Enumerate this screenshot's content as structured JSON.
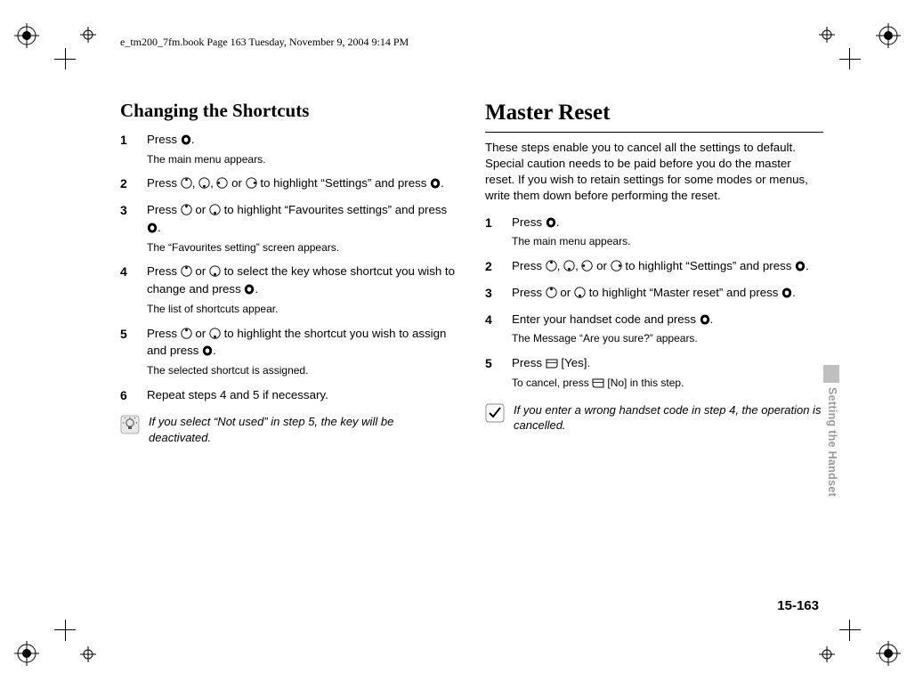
{
  "header": "e_tm200_7fm.book  Page 163  Tuesday, November 9, 2004  9:14 PM",
  "left": {
    "title": "Changing the Shortcuts",
    "steps": [
      {
        "num": "1",
        "main_pre": "Press ",
        "main_post": ".",
        "sub": "The main menu appears."
      },
      {
        "num": "2",
        "main_pre": "Press ",
        "main_mid": " to highlight “Settings” and press ",
        "main_post": "."
      },
      {
        "num": "3",
        "main_pre": "Press ",
        "main_mid": " to highlight “Favourites settings” and press ",
        "main_post": ".",
        "sub": "The “Favourites setting” screen appears."
      },
      {
        "num": "4",
        "main_pre": "Press ",
        "main_mid": " to select the key whose shortcut you wish to change and press ",
        "main_post": ".",
        "sub": "The list of shortcuts appear."
      },
      {
        "num": "5",
        "main_pre": "Press ",
        "main_mid": " to highlight the shortcut you wish to assign and press ",
        "main_post": ".",
        "sub": "The selected shortcut is assigned."
      },
      {
        "num": "6",
        "main": "Repeat steps 4 and 5 if necessary."
      }
    ],
    "note": "If you select “Not used” in step 5, the key will be deactivated."
  },
  "right": {
    "title": "Master Reset",
    "intro": "These steps enable you to cancel all the settings to default. Special caution needs to be paid before you do the master reset. If you wish to retain settings for some modes or menus, write them down before performing the reset.",
    "steps": [
      {
        "num": "1",
        "main_pre": "Press ",
        "main_post": ".",
        "sub": "The main menu appears."
      },
      {
        "num": "2",
        "main_pre": "Press ",
        "main_mid": " to highlight “Settings” and press ",
        "main_post": "."
      },
      {
        "num": "3",
        "main_pre": "Press ",
        "main_mid": " to highlight “Master reset” and press ",
        "main_post": "."
      },
      {
        "num": "4",
        "main_pre": "Enter your handset code and press ",
        "main_post": ".",
        "sub": "The Message “Are you sure?” appears."
      },
      {
        "num": "5",
        "main_pre": "Press ",
        "main_mid": " [Yes].",
        "sub_pre": "To cancel, press ",
        "sub_post": " [No] in this step."
      }
    ],
    "note": "If you enter a wrong handset code in step 4, the operation is cancelled."
  },
  "side_label": "Setting the Handset",
  "page_number": "15-163",
  "joiners": {
    "comma": ", ",
    "or": " or "
  }
}
